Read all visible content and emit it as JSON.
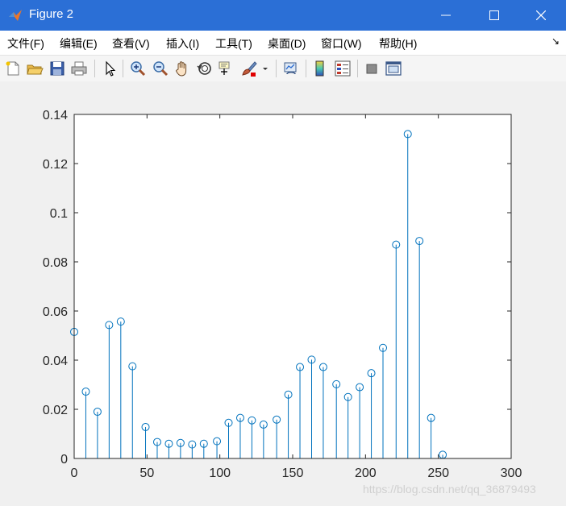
{
  "window": {
    "title": "Figure 2",
    "buttons": [
      "minimize",
      "maximize",
      "close"
    ]
  },
  "menu": {
    "items": [
      "文件(F)",
      "编辑(E)",
      "查看(V)",
      "插入(I)",
      "工具(T)",
      "桌面(D)",
      "窗口(W)",
      "帮助(H)"
    ],
    "overflow_glyph": "↘"
  },
  "toolbar": {
    "icons": [
      "new-figure-icon",
      "open-file-icon",
      "save-icon",
      "print-icon",
      "select-arrow-icon",
      "zoom-in-icon",
      "zoom-out-icon",
      "pan-hand-icon",
      "rotate-3d-icon",
      "data-cursor-icon",
      "brush-icon",
      "brush-dropdown-icon",
      "link-plot-icon",
      "colorbar-icon",
      "legend-icon",
      "hide-plot-tools-icon",
      "show-plot-tools-icon"
    ]
  },
  "watermark": "https://blog.csdn.net/qq_36879493",
  "chart_data": {
    "type": "stem",
    "color": "#0072bd",
    "marker": "circle",
    "xlim": [
      0,
      300
    ],
    "ylim": [
      0,
      0.14
    ],
    "xticks": [
      0,
      50,
      100,
      150,
      200,
      250,
      300
    ],
    "yticks": [
      0,
      0.02,
      0.04,
      0.06,
      0.08,
      0.1,
      0.12,
      0.14
    ],
    "xtick_labels": [
      "0",
      "50",
      "100",
      "150",
      "200",
      "250",
      "300"
    ],
    "ytick_labels": [
      "0",
      "0.02",
      "0.04",
      "0.06",
      "0.08",
      "0.1",
      "0.12",
      "0.14"
    ],
    "x": [
      0,
      8,
      16,
      24,
      32,
      40,
      49,
      57,
      65,
      73,
      81,
      89,
      98,
      106,
      114,
      122,
      130,
      139,
      147,
      155,
      163,
      171,
      180,
      188,
      196,
      204,
      212,
      221,
      229,
      237,
      245,
      253
    ],
    "y": [
      0.0515,
      0.0272,
      0.019,
      0.0543,
      0.0557,
      0.0375,
      0.0128,
      0.0067,
      0.006,
      0.0063,
      0.0057,
      0.006,
      0.007,
      0.0145,
      0.0165,
      0.0155,
      0.0138,
      0.0158,
      0.026,
      0.0372,
      0.0402,
      0.0372,
      0.0302,
      0.025,
      0.029,
      0.0347,
      0.045,
      0.087,
      0.132,
      0.0885,
      0.0165,
      0.0015
    ]
  }
}
